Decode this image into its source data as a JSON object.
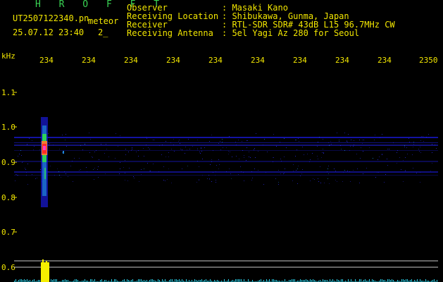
{
  "header": {
    "title": "H R O F F T",
    "filename": "UT2507122340.pn",
    "datetime": "25.07.12 23:40",
    "event_label": "meteor",
    "event_count": "2_"
  },
  "info": [
    {
      "key": "Observer",
      "value": ": Masaki Kano"
    },
    {
      "key": "Receiving Location",
      "value": ": Shibukawa, Gunma, Japan"
    },
    {
      "key": "Receiver",
      "value": ": RTL-SDR SDR# 43dB L15 96.7MHz CW"
    },
    {
      "key": "Receiving Antenna",
      "value": ": 5el Yagi Az 280 for Seoul"
    }
  ],
  "axis": {
    "y_unit": "kHz",
    "y_ticks": [
      "1.1",
      "1.0",
      "0.9",
      "0.8",
      "0.7",
      "0.6"
    ],
    "x_ticks": [
      "234",
      "234",
      "234",
      "234",
      "234",
      "234",
      "234",
      "234",
      "234",
      "2350"
    ]
  },
  "colors": {
    "background": "#000000",
    "label_yellow": "#f2e600",
    "title_green": "#39d353",
    "noise_blue": "#1a1ad8",
    "meteor_red": "#ff2a2a",
    "meteor_green": "#2bd05a",
    "baseline_cyan": "#28d0e8",
    "baseline_yellow": "#f5ee00"
  }
}
